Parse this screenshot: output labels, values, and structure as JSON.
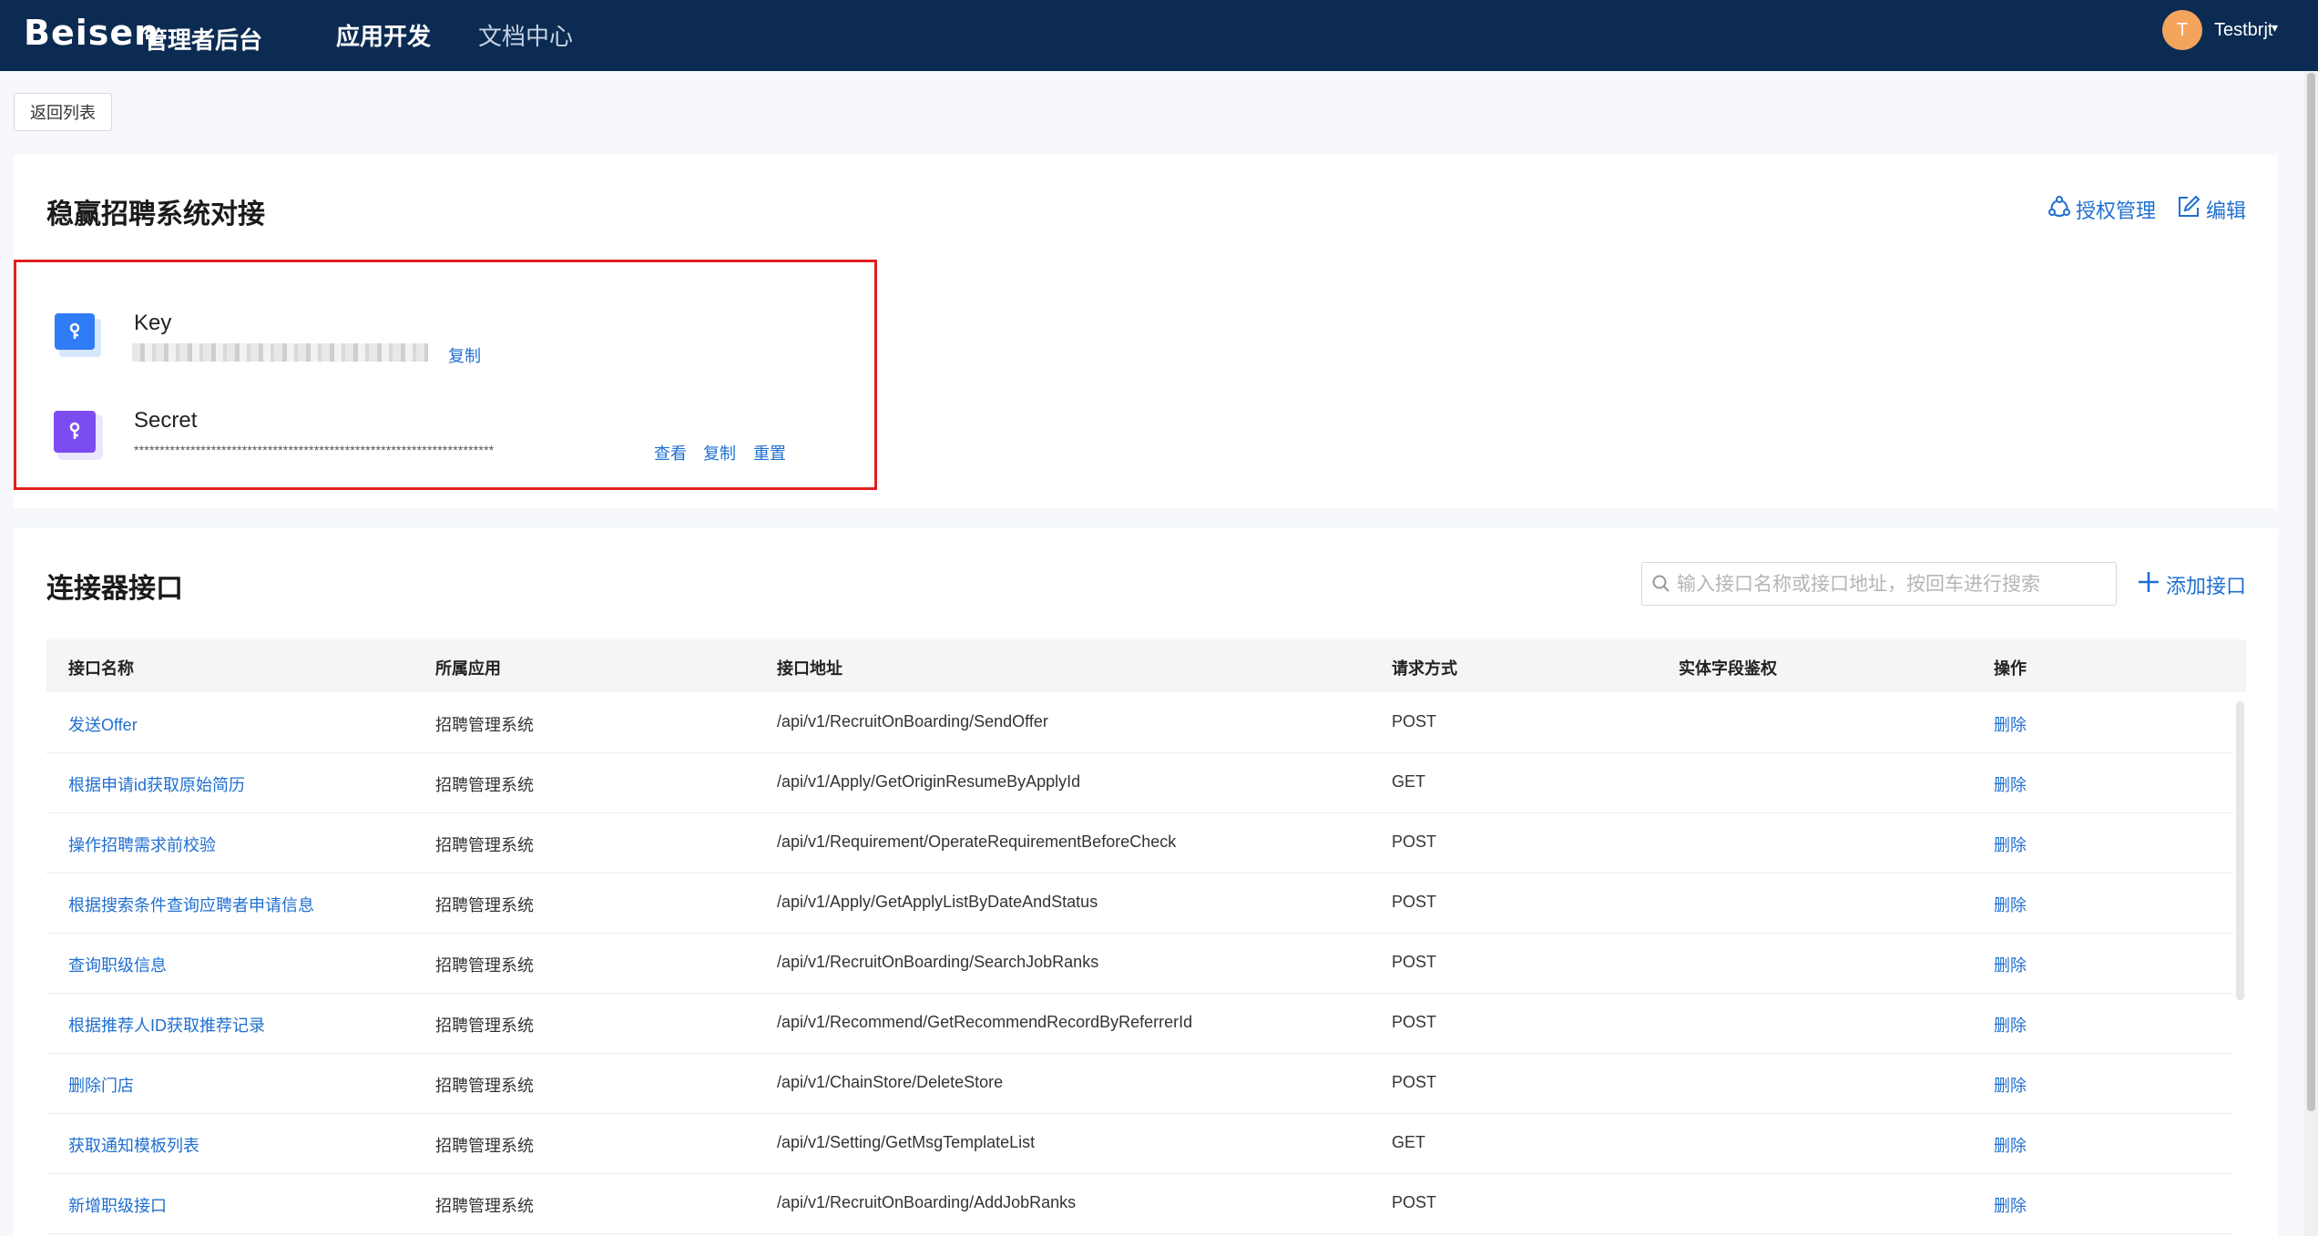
{
  "header": {
    "logo": "Beisen",
    "subtitle": "管理者后台",
    "nav": [
      "应用开发",
      "文档中心"
    ],
    "avatar_initial": "T",
    "username": "Testbrjt",
    "caret": "▾"
  },
  "back_button": "返回列表",
  "app_card": {
    "title": "稳赢招聘系统对接",
    "auth_manage": "授权管理",
    "edit": "编辑",
    "key_label": "Key",
    "key_copy": "复制",
    "secret_label": "Secret",
    "secret_masked": "**********************************************************************",
    "secret_view": "查看",
    "secret_copy": "复制",
    "secret_reset": "重置"
  },
  "connector": {
    "title": "连接器接口",
    "search_placeholder": "输入接口名称或接口地址，按回车进行搜索",
    "add_label": "添加接口",
    "columns": [
      "接口名称",
      "所属应用",
      "接口地址",
      "请求方式",
      "实体字段鉴权",
      "操作"
    ],
    "rows": [
      {
        "name": "发送Offer",
        "app": "招聘管理系统",
        "path": "/api/v1/RecruitOnBoarding/SendOffer",
        "method": "POST",
        "auth": "",
        "action": "删除"
      },
      {
        "name": "根据申请id获取原始简历",
        "app": "招聘管理系统",
        "path": "/api/v1/Apply/GetOriginResumeByApplyId",
        "method": "GET",
        "auth": "",
        "action": "删除"
      },
      {
        "name": "操作招聘需求前校验",
        "app": "招聘管理系统",
        "path": "/api/v1/Requirement/OperateRequirementBeforeCheck",
        "method": "POST",
        "auth": "",
        "action": "删除"
      },
      {
        "name": "根据搜索条件查询应聘者申请信息",
        "app": "招聘管理系统",
        "path": "/api/v1/Apply/GetApplyListByDateAndStatus",
        "method": "POST",
        "auth": "",
        "action": "删除"
      },
      {
        "name": "查询职级信息",
        "app": "招聘管理系统",
        "path": "/api/v1/RecruitOnBoarding/SearchJobRanks",
        "method": "POST",
        "auth": "",
        "action": "删除"
      },
      {
        "name": "根据推荐人ID获取推荐记录",
        "app": "招聘管理系统",
        "path": "/api/v1/Recommend/GetRecommendRecordByReferrerId",
        "method": "POST",
        "auth": "",
        "action": "删除"
      },
      {
        "name": "删除门店",
        "app": "招聘管理系统",
        "path": "/api/v1/ChainStore/DeleteStore",
        "method": "POST",
        "auth": "",
        "action": "删除"
      },
      {
        "name": "获取通知模板列表",
        "app": "招聘管理系统",
        "path": "/api/v1/Setting/GetMsgTemplateList",
        "method": "GET",
        "auth": "",
        "action": "删除"
      },
      {
        "name": "新增职级接口",
        "app": "招聘管理系统",
        "path": "/api/v1/RecruitOnBoarding/AddJobRanks",
        "method": "POST",
        "auth": "",
        "action": "删除"
      }
    ]
  },
  "colors": {
    "nav_bg": "#0b2b52",
    "link": "#1f6fd0",
    "highlight": "#e02020",
    "key_icon": "#2f7cf6",
    "secret_icon": "#7b4df0"
  }
}
